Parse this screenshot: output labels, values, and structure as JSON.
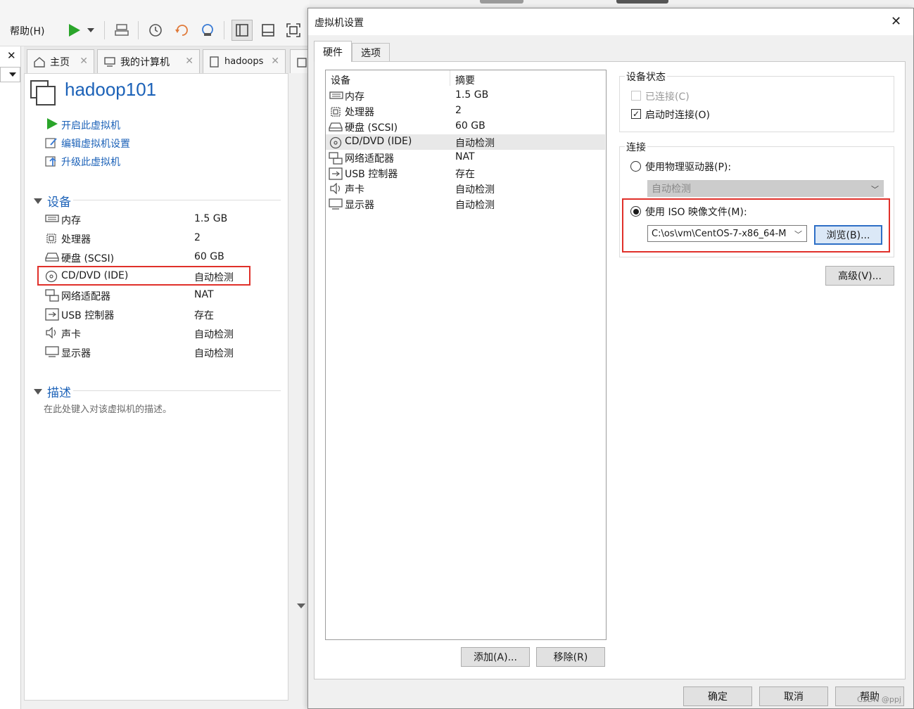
{
  "menu": {
    "help": "帮助(H)"
  },
  "tabs": [
    {
      "label": "主页"
    },
    {
      "label": "我的计算机"
    },
    {
      "label": "hadoops"
    }
  ],
  "vm": {
    "name": "hadoop101",
    "actions": [
      "开启此虚拟机",
      "编辑虚拟机设置",
      "升级此虚拟机"
    ]
  },
  "devices_section": {
    "title": "设备",
    "items": [
      {
        "name": "内存",
        "value": "1.5 GB"
      },
      {
        "name": "处理器",
        "value": "2"
      },
      {
        "name": "硬盘 (SCSI)",
        "value": "60 GB"
      },
      {
        "name": "CD/DVD (IDE)",
        "value": "自动检测"
      },
      {
        "name": "网络适配器",
        "value": "NAT"
      },
      {
        "name": "USB 控制器",
        "value": "存在"
      },
      {
        "name": "声卡",
        "value": "自动检测"
      },
      {
        "name": "显示器",
        "value": "自动检测"
      }
    ]
  },
  "description_section": {
    "title": "描述",
    "placeholder": "在此处键入对该虚拟机的描述。"
  },
  "dialog": {
    "title": "虚拟机设置",
    "tabs": [
      "硬件",
      "选项"
    ],
    "list_headers": {
      "device": "设备",
      "summary": "摘要"
    },
    "devices": [
      {
        "name": "内存",
        "value": "1.5 GB"
      },
      {
        "name": "处理器",
        "value": "2"
      },
      {
        "name": "硬盘 (SCSI)",
        "value": "60 GB"
      },
      {
        "name": "CD/DVD (IDE)",
        "value": "自动检测"
      },
      {
        "name": "网络适配器",
        "value": "NAT"
      },
      {
        "name": "USB 控制器",
        "value": "存在"
      },
      {
        "name": "声卡",
        "value": "自动检测"
      },
      {
        "name": "显示器",
        "value": "自动检测"
      }
    ],
    "add_button": "添加(A)...",
    "remove_button": "移除(R)",
    "device_status": {
      "title": "设备状态",
      "connected": "已连接(C)",
      "connect_at_power_on": "启动时连接(O)"
    },
    "connection": {
      "title": "连接",
      "physical_drive": "使用物理驱动器(P):",
      "physical_drive_value": "自动检测",
      "iso_image": "使用 ISO 映像文件(M):",
      "iso_path": "C:\\os\\vm\\CentOS-7-x86_64-M",
      "browse_button": "浏览(B)..."
    },
    "advanced_button": "高级(V)...",
    "ok_button": "确定",
    "cancel_button": "取消",
    "help_button": "帮助"
  },
  "watermark": "CSDN @ppj",
  "colors": {
    "accent_blue": "#1c62b8",
    "highlight_red": "#e0302a",
    "play_green": "#2aa52a"
  }
}
